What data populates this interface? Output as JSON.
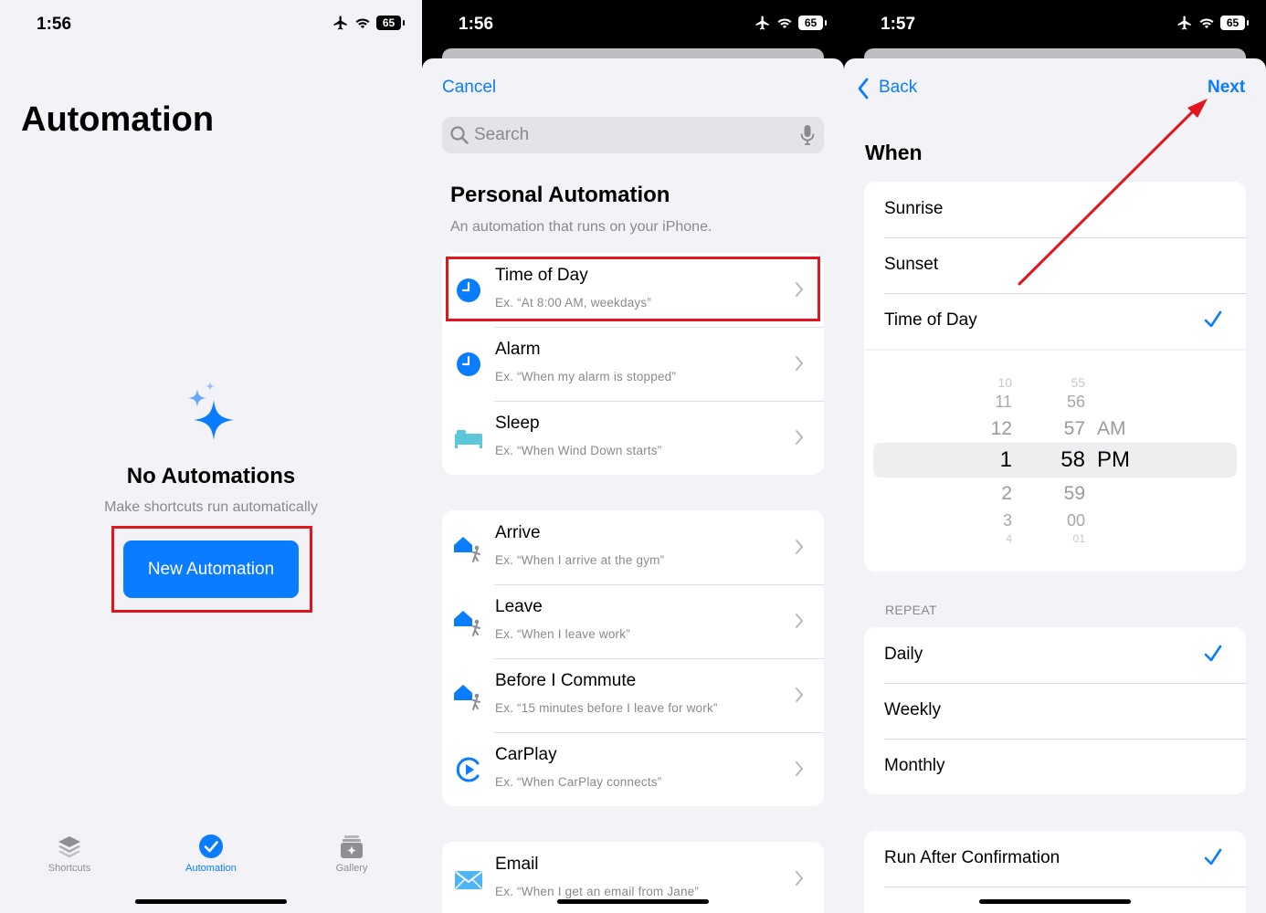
{
  "panel1": {
    "status": {
      "time": "1:56",
      "battery": "65"
    },
    "title": "Automation",
    "empty": {
      "title": "No Automations",
      "subtitle": "Make shortcuts run automatically"
    },
    "new_button": "New Automation",
    "tabs": [
      {
        "label": "Shortcuts",
        "icon": "layers-icon"
      },
      {
        "label": "Automation",
        "icon": "check-circle-icon",
        "active": true
      },
      {
        "label": "Gallery",
        "icon": "gallery-icon"
      }
    ]
  },
  "panel2": {
    "status": {
      "time": "1:56",
      "battery": "65"
    },
    "cancel": "Cancel",
    "search": {
      "placeholder": "Search"
    },
    "section": {
      "title": "Personal Automation",
      "subtitle": "An automation that runs on your iPhone."
    },
    "group1": [
      {
        "title": "Time of Day",
        "subtitle": "Ex. “At 8:00 AM, weekdays”",
        "icon": "clock-icon"
      },
      {
        "title": "Alarm",
        "subtitle": "Ex. “When my alarm is stopped”",
        "icon": "clock-icon"
      },
      {
        "title": "Sleep",
        "subtitle": "Ex. “When Wind Down starts”",
        "icon": "bed-icon"
      }
    ],
    "group2": [
      {
        "title": "Arrive",
        "subtitle": "Ex. “When I arrive at the gym”",
        "icon": "home-walker-icon"
      },
      {
        "title": "Leave",
        "subtitle": "Ex. “When I leave work”",
        "icon": "home-walker-icon"
      },
      {
        "title": "Before I Commute",
        "subtitle": "Ex. “15 minutes before I leave for work”",
        "icon": "home-walker-icon"
      },
      {
        "title": "CarPlay",
        "subtitle": "Ex. “When CarPlay connects”",
        "icon": "carplay-icon"
      }
    ],
    "group3": [
      {
        "title": "Email",
        "subtitle": "Ex. “When I get an email from Jane”",
        "icon": "envelope-icon"
      }
    ]
  },
  "panel3": {
    "status": {
      "time": "1:57",
      "battery": "65"
    },
    "back": "Back",
    "next": "Next",
    "when_title": "When",
    "when_options": [
      {
        "label": "Sunrise",
        "selected": false
      },
      {
        "label": "Sunset",
        "selected": false
      },
      {
        "label": "Time of Day",
        "selected": true
      }
    ],
    "picker": {
      "hours": [
        "10",
        "11",
        "12",
        "1",
        "2",
        "3",
        "4"
      ],
      "minutes": [
        "55",
        "56",
        "57",
        "58",
        "59",
        "00",
        "01"
      ],
      "periods": [
        "AM",
        "PM"
      ],
      "selected": {
        "hour": "1",
        "minute": "58",
        "period": "PM"
      }
    },
    "repeat_header": "REPEAT",
    "repeat_options": [
      {
        "label": "Daily",
        "selected": true
      },
      {
        "label": "Weekly",
        "selected": false
      },
      {
        "label": "Monthly",
        "selected": false
      }
    ],
    "confirm_options": [
      {
        "label": "Run After Confirmation",
        "selected": true
      }
    ]
  },
  "colors": {
    "accent": "#0a7cff",
    "highlight": "#e1151d",
    "background": "#f2f2f7"
  }
}
